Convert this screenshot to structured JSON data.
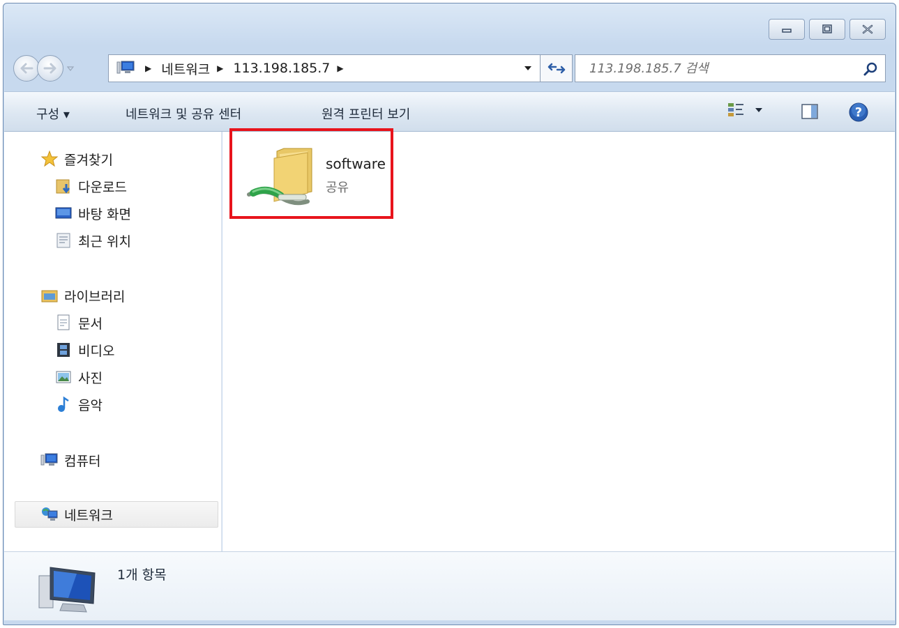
{
  "window": {
    "caption_buttons": [
      "minimize",
      "maximize",
      "close"
    ]
  },
  "address_bar": {
    "breadcrumbs": [
      {
        "label": "네트워크",
        "icon": "network-computer-icon"
      },
      {
        "label": "113.198.185.7"
      }
    ]
  },
  "search": {
    "placeholder": "113.198.185.7 검색"
  },
  "command_bar": {
    "organize_label": "구성 ▾",
    "network_center_label": "네트워크 및 공유 센터",
    "remote_printers_label": "원격 프린터 보기"
  },
  "nav_pane": {
    "favorites": {
      "label": "즐겨찾기",
      "items": [
        "다운로드",
        "바탕 화면",
        "최근 위치"
      ]
    },
    "libraries": {
      "label": "라이브러리",
      "items": [
        "문서",
        "비디오",
        "사진",
        "음악"
      ]
    },
    "computer": {
      "label": "컴퓨터"
    },
    "network": {
      "label": "네트워크"
    }
  },
  "content": {
    "items": [
      {
        "name": "software",
        "type": "공유",
        "icon": "shared-folder-icon",
        "highlighted": true
      }
    ]
  },
  "details": {
    "item_count": "1개 항목"
  },
  "colors": {
    "highlight": "#e8141c",
    "window_frame": "#c7d9ee",
    "command_bar": "#dde7f2"
  }
}
